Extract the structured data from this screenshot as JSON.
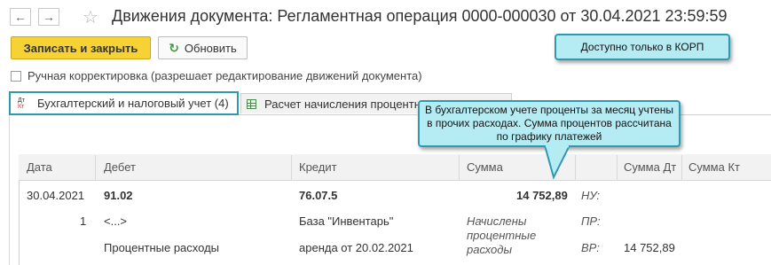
{
  "titlebar": {
    "back_icon": "arrow-left-icon",
    "forward_icon": "arrow-right-icon",
    "back_glyph": "←",
    "forward_glyph": "→",
    "star_glyph": "☆",
    "title": "Движения документа: Регламентная операция 0000-000030 от 30.04.2021 23:59:59"
  },
  "toolbar": {
    "save_close_label": "Записать и закрыть",
    "refresh_label": "Обновить",
    "refresh_glyph": "↻"
  },
  "manual_edit": {
    "label": "Ручная корректировка (разрешает редактирование движений документа)",
    "checked": false
  },
  "tabs": [
    {
      "label": "Бухгалтерский и налоговый учет (4)",
      "icon_top": "Дт",
      "icon_bottom": "Кт",
      "active": true
    },
    {
      "label": "Расчет начисления процентных",
      "active": false
    }
  ],
  "table": {
    "headers": {
      "date": "Дата",
      "debit": "Дебет",
      "credit": "Кредит",
      "sum": "Сумма",
      "sum_dt": "Сумма Дт",
      "sum_kt": "Сумма Кт"
    },
    "row1": {
      "date": "30.04.2021",
      "debit": "91.02",
      "credit": "76.07.5",
      "sum": "14 752,89",
      "nu": "НУ:",
      "pr": "ПР:",
      "vr": "ВР:",
      "vr_sum_dt": "14 752,89"
    },
    "row2": {
      "num": "1",
      "debit_sub1": "<...>",
      "credit_sub1": "База \"Инвентарь\"",
      "content": [
        "Начислены",
        "процентные",
        "расходы"
      ]
    },
    "row3": {
      "debit_sub2": "Процентные расходы",
      "credit_sub2": "аренда от 20.02.2021"
    }
  },
  "callouts": {
    "korp": "Доступно только в КОРП",
    "interest": "В бухгалтерском учете проценты за месяц учтены в прочих расходах. Сумма процентов рассчитана по графику платежей"
  },
  "colors": {
    "primary_button": "#f6d235",
    "callout_bg": "#b5ecf3",
    "callout_border": "#2e9ab2",
    "refresh_icon": "#3c9a3c"
  }
}
